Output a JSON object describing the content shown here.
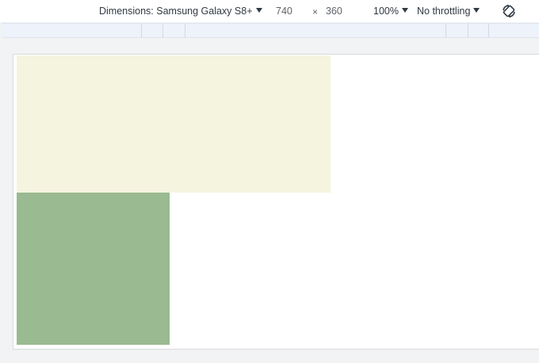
{
  "toolbar": {
    "dimensions_label": "Dimensions: Samsung Galaxy S8+",
    "width_value": "740",
    "times_symbol": "×",
    "height_value": "360",
    "zoom_label": "100%",
    "throttling_label": "No throttling",
    "rotate_icon": "rotate-icon"
  },
  "page": {
    "blocks": [
      {
        "name": "cream-block",
        "color": "#f5f4df"
      },
      {
        "name": "green-block",
        "color": "#9aba91"
      }
    ]
  }
}
